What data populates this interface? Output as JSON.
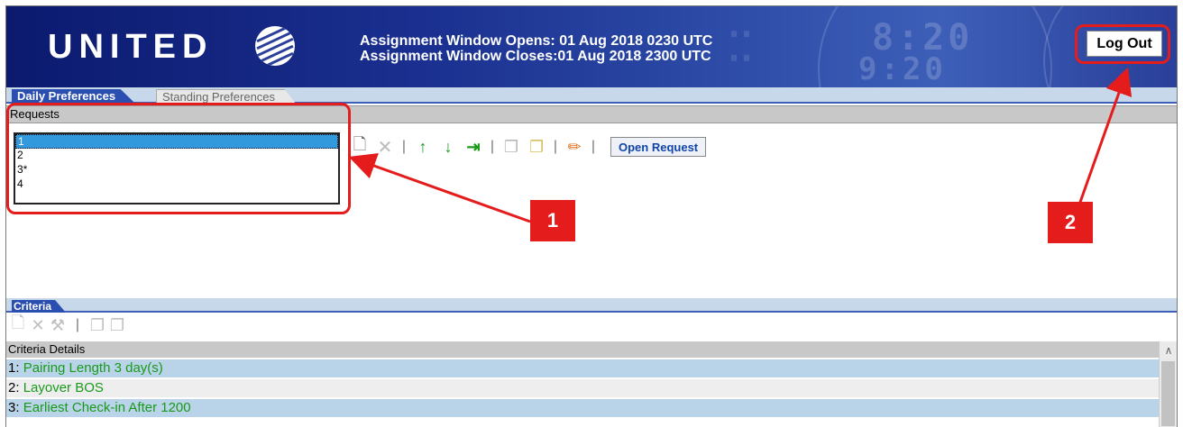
{
  "header": {
    "logo_text": "UNITED",
    "window_opens": "Assignment Window Opens: 01 Aug 2018 0230 UTC",
    "window_closes": "Assignment Window Closes:01 Aug 2018 2300 UTC",
    "logout_label": "Log Out"
  },
  "tabs": [
    {
      "label": "Daily Preferences",
      "active": true
    },
    {
      "label": "Standing Preferences",
      "active": false
    }
  ],
  "requests": {
    "section_label": "Requests",
    "items": [
      "1",
      "2",
      "3*",
      "4"
    ],
    "selected_index": 0,
    "open_request_label": "Open Request"
  },
  "criteria": {
    "tab_label": "Criteria",
    "details_label": "Criteria Details",
    "rows": [
      {
        "num": "1:",
        "text": "Pairing Length 3 day(s)"
      },
      {
        "num": "2:",
        "text": "Layover BOS"
      },
      {
        "num": "3:",
        "text": "Earliest Check-in After 1200"
      }
    ]
  },
  "callouts": [
    {
      "label": "1"
    },
    {
      "label": "2"
    }
  ],
  "colors": {
    "brand_blue": "#1a2f8f",
    "callout_red": "#e51c1c",
    "criteria_green": "#1a9a1a",
    "selection_blue": "#3399dd"
  },
  "icons": {
    "toolbar": [
      "new-icon",
      "delete-icon",
      "move-up-icon",
      "move-down-icon",
      "move-to-icon",
      "copy-icon",
      "paste-icon",
      "edit-pencil-icon"
    ],
    "criteria_toolbar": [
      "new-icon",
      "delete-icon",
      "wrench-icon",
      "copy-icon",
      "paste-icon"
    ]
  }
}
